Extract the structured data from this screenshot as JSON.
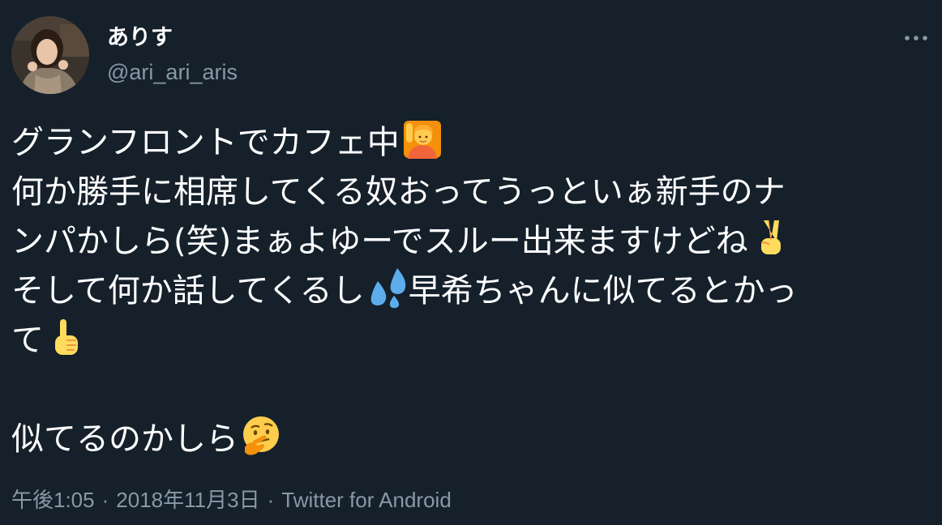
{
  "user": {
    "display_name": "ありす",
    "handle": "@ari_ari_aris"
  },
  "tweet": {
    "lines": [
      "グランフロントでカフェ中",
      "何か勝手に相席してくる奴おってうっといぁ新手のナ",
      "ンパかしら(笑)まぁよゆーでスルー出来ますけどね",
      "そして何か話してくるし",
      "早希ちゃんに似てるとかっ",
      "て",
      "似てるのかしら"
    ],
    "emojis": [
      "person-raising-hand-emoji",
      "victory-hand-emoji",
      "sweat-droplets-emoji",
      "pointing-up-emoji",
      "thinking-face-emoji"
    ]
  },
  "meta": {
    "time": "午後1:05",
    "separator": "·",
    "date": "2018年11月3日",
    "source": "Twitter for Android"
  },
  "colors": {
    "background": "#15202b",
    "text": "#ffffff",
    "secondary": "#8899a6"
  }
}
